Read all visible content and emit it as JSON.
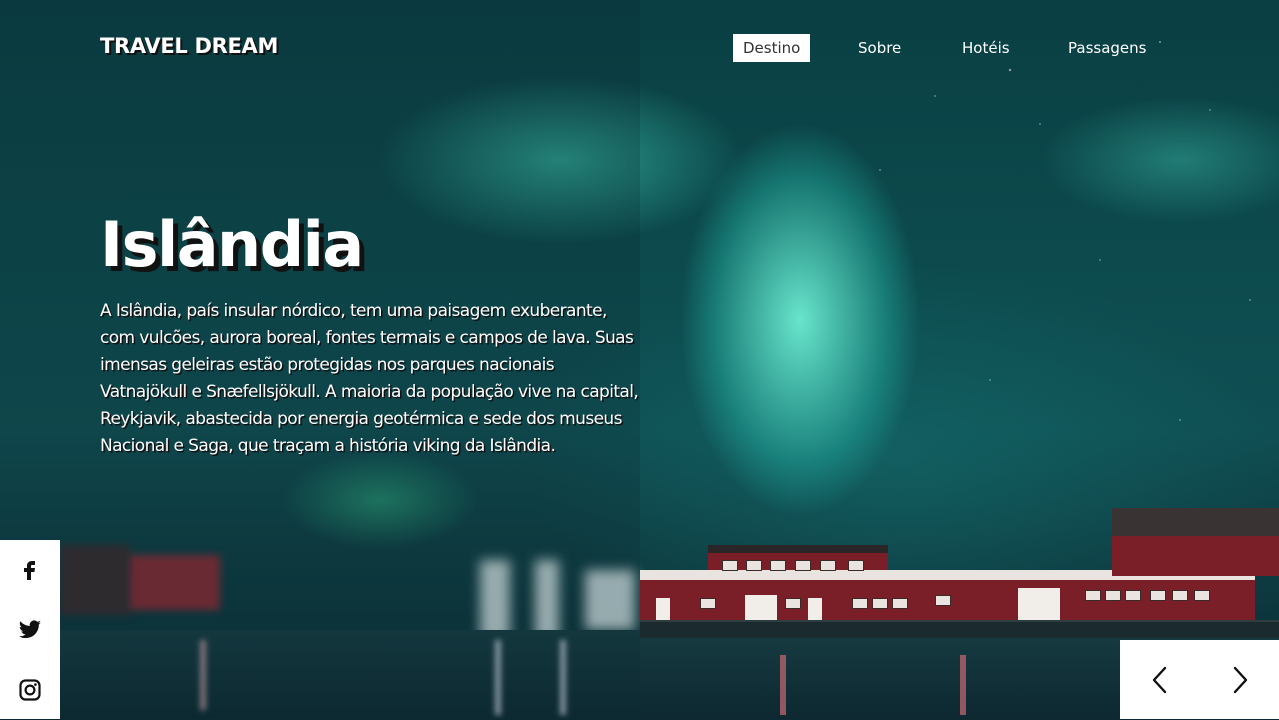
{
  "header": {
    "logo": "TRAVEL DREAM"
  },
  "nav": {
    "items": [
      {
        "label": "Destino",
        "active": true
      },
      {
        "label": "Sobre",
        "active": false
      },
      {
        "label": "Hotéis",
        "active": false
      },
      {
        "label": "Passagens",
        "active": false
      }
    ]
  },
  "hero": {
    "title": "Islândia",
    "description": "A Islândia, país insular nórdico, tem uma paisagem exuberante, com vulcões, aurora boreal, fontes termais e campos de lava. Suas imensas geleiras estão protegidas nos parques nacionais Vatnajökull e Snæfellsjökull. A maioria da população vive na capital, Reykjavik, abastecida por energia geotérmica e sede dos museus Nacional e Saga, que traçam a história viking da Islândia."
  },
  "social": {
    "items": [
      {
        "icon": "facebook-icon"
      },
      {
        "icon": "twitter-icon"
      },
      {
        "icon": "instagram-icon"
      }
    ]
  },
  "slider": {
    "prev_icon": "chevron-left-icon",
    "next_icon": "chevron-right-icon"
  },
  "colors": {
    "aurora": "#4ff0d0",
    "building": "#7a1f28",
    "panel": "#ffffff"
  }
}
